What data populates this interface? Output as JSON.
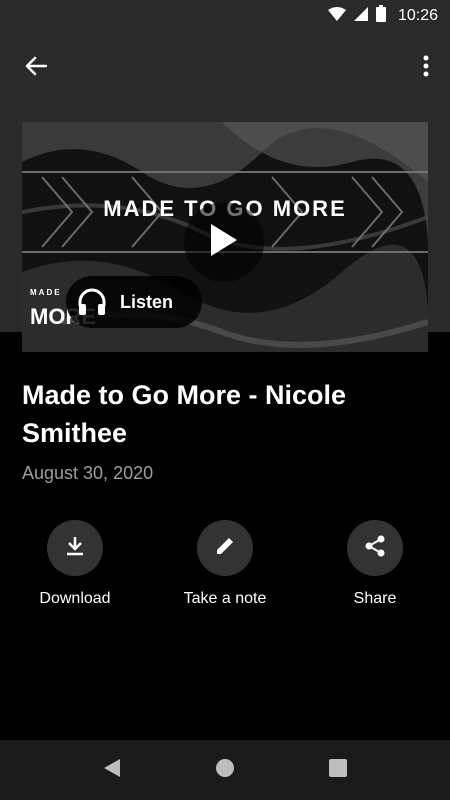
{
  "status_bar": {
    "time": "10:26"
  },
  "media": {
    "banner_text": "MADE TO GO MORE",
    "logo_text_top": "MADE",
    "logo_text_bottom": "MORE",
    "listen_label": "Listen"
  },
  "episode": {
    "title": "Made to Go More - Nicole Smithee",
    "date": "August 30, 2020"
  },
  "actions": [
    {
      "label": "Download",
      "icon": "download-icon"
    },
    {
      "label": "Take a note",
      "icon": "pencil-icon"
    },
    {
      "label": "Share",
      "icon": "share-icon"
    }
  ],
  "nav": [
    "back-icon",
    "home-icon",
    "recents-icon"
  ],
  "colors": {
    "bar": "#2a2a2a",
    "background": "#000000",
    "date_text": "#9e9e9e",
    "action_circle": "#333333"
  }
}
